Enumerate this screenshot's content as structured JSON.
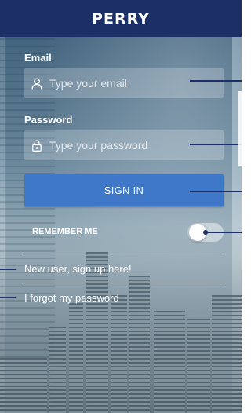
{
  "header": {
    "logo_text": "PERRY",
    "background_color": "#1c2f66"
  },
  "form": {
    "email_label": "Email",
    "email_placeholder": "Type your email",
    "password_label": "Password",
    "password_placeholder": "Type your password",
    "signin_label": "SIGN IN",
    "signin_color": "#3f78c9",
    "remember_label": "REMEMBER ME",
    "remember_on": false
  },
  "links": {
    "signup": "New user, sign up here!",
    "forgot": "I forgot my password"
  },
  "icons": {
    "email": "user-icon",
    "password": "lock-icon"
  }
}
